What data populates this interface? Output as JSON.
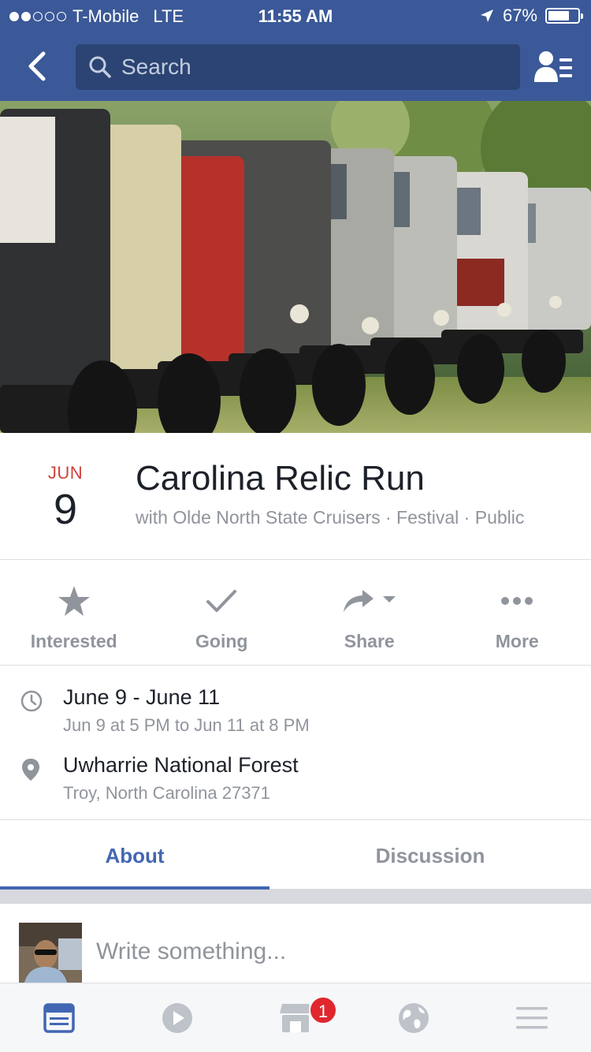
{
  "status_bar": {
    "carrier": "T-Mobile",
    "network": "LTE",
    "time": "11:55 AM",
    "battery": "67%",
    "battery_level": 0.67,
    "signal_bars_filled": 2,
    "signal_bars_total": 5
  },
  "nav": {
    "search_placeholder": "Search"
  },
  "event": {
    "month": "JUN",
    "day": "9",
    "title": "Carolina Relic Run",
    "subtitle": "with Olde North State Cruisers · Festival · Public"
  },
  "actions": [
    {
      "label": "Interested",
      "icon": "star-icon"
    },
    {
      "label": "Going",
      "icon": "checkmark-icon"
    },
    {
      "label": "Share",
      "icon": "share-icon"
    },
    {
      "label": "More",
      "icon": "more-icon"
    }
  ],
  "details": {
    "date_range": "June 9 - June 11",
    "time_range": "Jun 9 at 5 PM to Jun 11 at 8 PM",
    "location_name": "Uwharrie National Forest",
    "location_address": "Troy, North Carolina 27371"
  },
  "tabs": [
    {
      "label": "About",
      "active": true
    },
    {
      "label": "Discussion",
      "active": false
    }
  ],
  "composer": {
    "placeholder": "Write something..."
  },
  "tab_bar": {
    "items": [
      "news-feed-icon",
      "video-icon",
      "marketplace-icon",
      "notifications-globe-icon",
      "menu-icon"
    ],
    "marketplace_badge": "1"
  },
  "colors": {
    "brand": "#3b5998",
    "accent": "#4267b2",
    "date_red": "#d0413b",
    "badge_red": "#e0262e",
    "muted": "#90949c"
  }
}
